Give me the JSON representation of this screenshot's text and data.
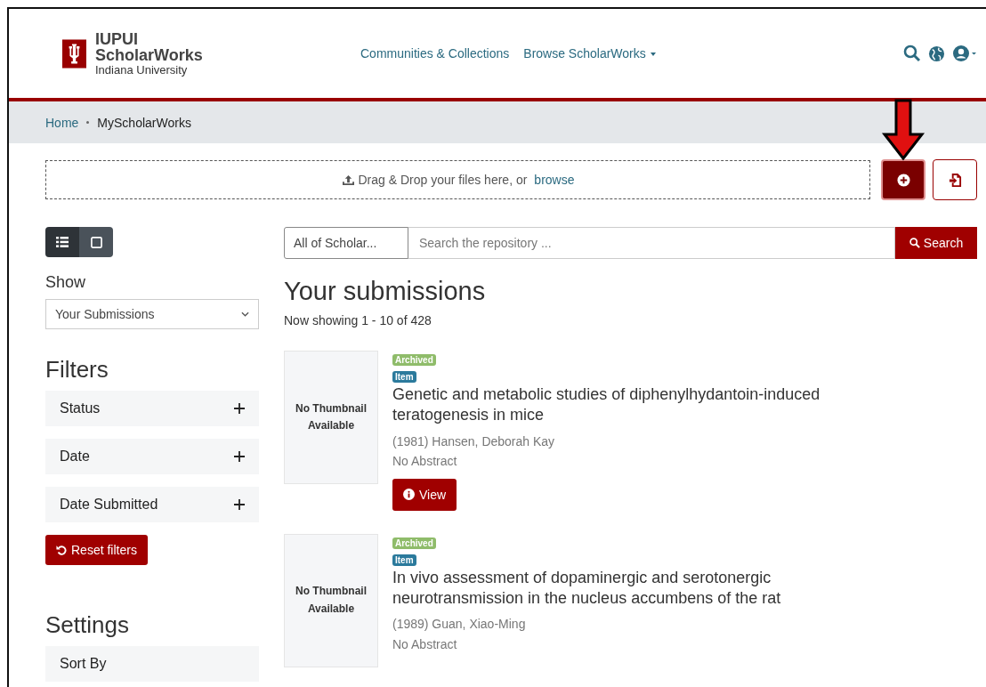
{
  "header": {
    "logo_line1": "IUPUI",
    "logo_line2": "ScholarWorks",
    "logo_line3": "Indiana University",
    "nav": [
      {
        "label": "Communities & Collections",
        "dropdown": false
      },
      {
        "label": "Browse ScholarWorks",
        "dropdown": true
      }
    ]
  },
  "breadcrumb": [
    {
      "label": "Home",
      "link": true
    },
    {
      "label": "MyScholarWorks",
      "link": false
    }
  ],
  "upload": {
    "text": "Drag & Drop your files here, or",
    "link": "browse"
  },
  "view_modes": [
    {
      "kind": "list",
      "selected": true
    },
    {
      "kind": "grid",
      "selected": false
    }
  ],
  "show": {
    "label": "Show",
    "value": "Your Submissions"
  },
  "filters": {
    "title": "Filters",
    "items": [
      {
        "label": "Status",
        "expanded": false
      },
      {
        "label": "Date",
        "expanded": false
      },
      {
        "label": "Date Submitted",
        "expanded": false
      }
    ],
    "reset": "Reset filters"
  },
  "settings": {
    "title": "Settings",
    "items": [
      {
        "label": "Sort By"
      }
    ]
  },
  "search": {
    "scope": "All of Scholar...",
    "placeholder": "Search the repository ...",
    "button": "Search"
  },
  "results": {
    "title": "Your submissions",
    "count": "Now showing 1 - 10 of 428",
    "items": [
      {
        "thumbnail": "No Thumbnail Available",
        "badges": [
          {
            "label": "Archived",
            "color": "#8fbc6a"
          },
          {
            "label": "Item",
            "color": "#2b7a9c"
          }
        ],
        "title": "Genetic and metabolic studies of diphenylhydantoin-induced teratogenesis in mice",
        "meta": "(1981) Hansen, Deborah Kay",
        "abstract": "No Abstract",
        "button": "View"
      },
      {
        "thumbnail": "No Thumbnail Available",
        "badges": [
          {
            "label": "Archived",
            "color": "#8fbc6a"
          },
          {
            "label": "Item",
            "color": "#2b7a9c"
          }
        ],
        "title": "In vivo assessment of dopaminergic and serotonergic neurotransmission in the nucleus accumbens of the rat",
        "meta": "(1989) Guan, Xiao-Ming",
        "abstract": "No Abstract"
      }
    ]
  }
}
